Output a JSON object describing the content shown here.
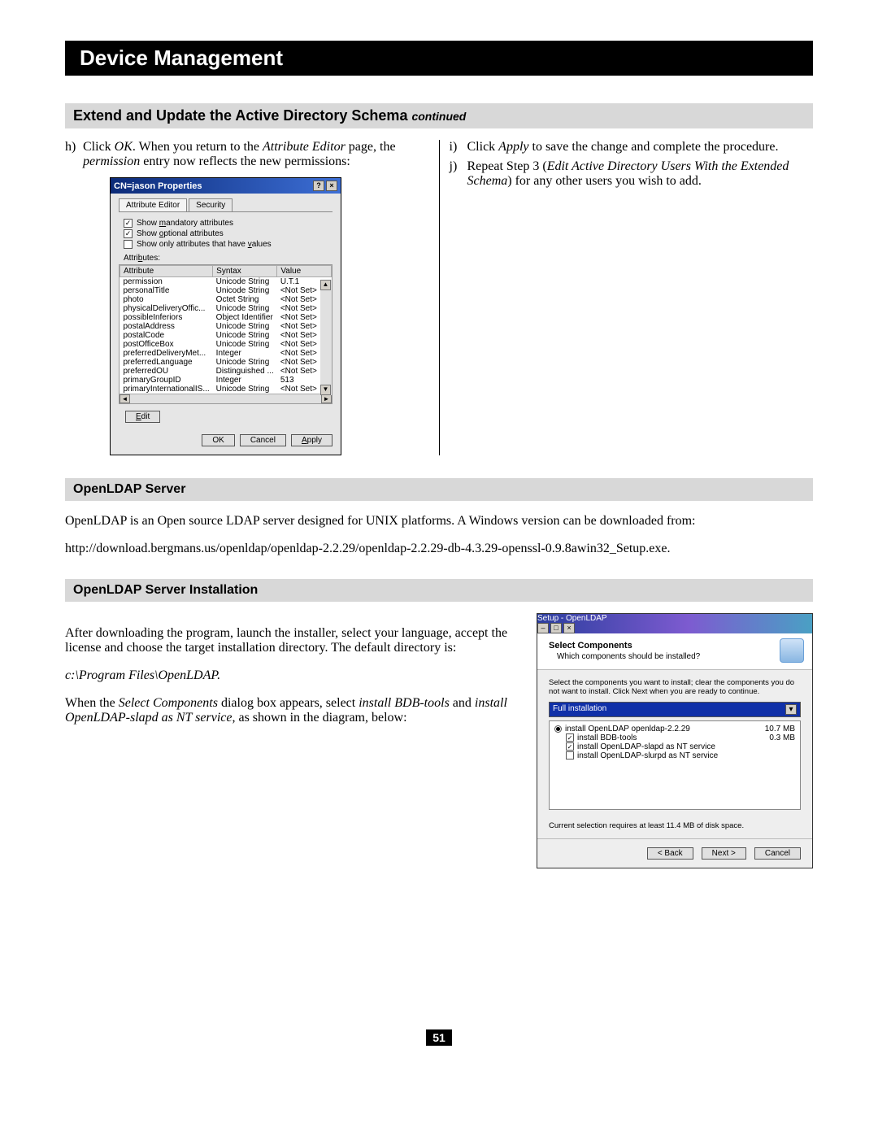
{
  "header": {
    "title": "Device Management"
  },
  "section1": {
    "title": "Extend and Update the Active Directory Schema",
    "suffix": "continued",
    "step_h": {
      "marker": "h)",
      "pre": "Click ",
      "ok": "OK",
      "mid1": ". When you return to the ",
      "page": "Attribute Editor",
      "mid2": " page, the ",
      "perm": "permission",
      "post": " entry now reflects the new permissions:"
    },
    "step_i": {
      "marker": "i)",
      "pre": "Click ",
      "apply": "Apply",
      "post": " to save the change and complete the procedure."
    },
    "step_j": {
      "marker": "j)",
      "pre": "Repeat Step 3 (",
      "ital": "Edit Active Directory Users With the Extended Schema",
      "post": ") for any other users you wish to add."
    }
  },
  "dialog1": {
    "title": "CN=jason Properties",
    "tab_active": "Attribute Editor",
    "tab_other": "Security",
    "chk_mandatory": "Show mandatory attributes",
    "chk_optional": "Show optional attributes",
    "chk_values": "Show only attributes that have values",
    "attributes_label": "Attributes:",
    "col_attr": "Attribute",
    "col_syntax": "Syntax",
    "col_value": "Value",
    "rows": [
      {
        "a": "permission",
        "s": "Unicode String",
        "v": "U.T.1"
      },
      {
        "a": "personalTitle",
        "s": "Unicode String",
        "v": "<Not Set>"
      },
      {
        "a": "photo",
        "s": "Octet String",
        "v": "<Not Set>"
      },
      {
        "a": "physicalDeliveryOffic...",
        "s": "Unicode String",
        "v": "<Not Set>"
      },
      {
        "a": "possibleInferiors",
        "s": "Object Identifier",
        "v": "<Not Set>"
      },
      {
        "a": "postalAddress",
        "s": "Unicode String",
        "v": "<Not Set>"
      },
      {
        "a": "postalCode",
        "s": "Unicode String",
        "v": "<Not Set>"
      },
      {
        "a": "postOfficeBox",
        "s": "Unicode String",
        "v": "<Not Set>"
      },
      {
        "a": "preferredDeliveryMet...",
        "s": "Integer",
        "v": "<Not Set>"
      },
      {
        "a": "preferredLanguage",
        "s": "Unicode String",
        "v": "<Not Set>"
      },
      {
        "a": "preferredOU",
        "s": "Distinguished ...",
        "v": "<Not Set>"
      },
      {
        "a": "primaryGroupID",
        "s": "Integer",
        "v": "513"
      },
      {
        "a": "primaryInternationalIS...",
        "s": "Unicode String",
        "v": "<Not Set>"
      }
    ],
    "edit": "Edit",
    "ok": "OK",
    "cancel": "Cancel",
    "apply": "Apply"
  },
  "section2": {
    "title": "OpenLDAP Server",
    "p1": "OpenLDAP is an Open source LDAP server designed for UNIX platforms. A Windows version can be downloaded from:",
    "p2": "http://download.bergmans.us/openldap/openldap-2.2.29/openldap-2.2.29-db-4.3.29-openssl-0.9.8awin32_Setup.exe."
  },
  "section3": {
    "title": "OpenLDAP Server Installation",
    "p1": "After downloading the program, launch the installer, select your language, accept the license and choose the target installation directory. The default directory is:",
    "path": "c:\\Program Files\\OpenLDAP.",
    "p3a": "When the ",
    "p3b": "Select Components",
    "p3c": " dialog box appears, select ",
    "p3d": "install BDB-tools",
    "p3e": " and ",
    "p3f": "install OpenLDAP-slapd as NT service",
    "p3g": ", as shown in the diagram, below:"
  },
  "dialog2": {
    "title": "Setup - OpenLDAP",
    "hdr_title": "Select Components",
    "hdr_sub": "Which components should be installed?",
    "note": "Select the components you want to install; clear the components you do not want to install. Click Next when you are ready to continue.",
    "combo": "Full installation",
    "row1_label": "install OpenLDAP openldap-2.2.29",
    "row1_size": "10.7 MB",
    "row2_label": "install BDB-tools",
    "row2_size": "0.3 MB",
    "row3_label": "install OpenLDAP-slapd as NT service",
    "row4_label": "install OpenLDAP-slurpd as NT service",
    "status": "Current selection requires at least 11.4 MB of disk space.",
    "back": "< Back",
    "next": "Next >",
    "cancel": "Cancel"
  },
  "page_number": "51"
}
